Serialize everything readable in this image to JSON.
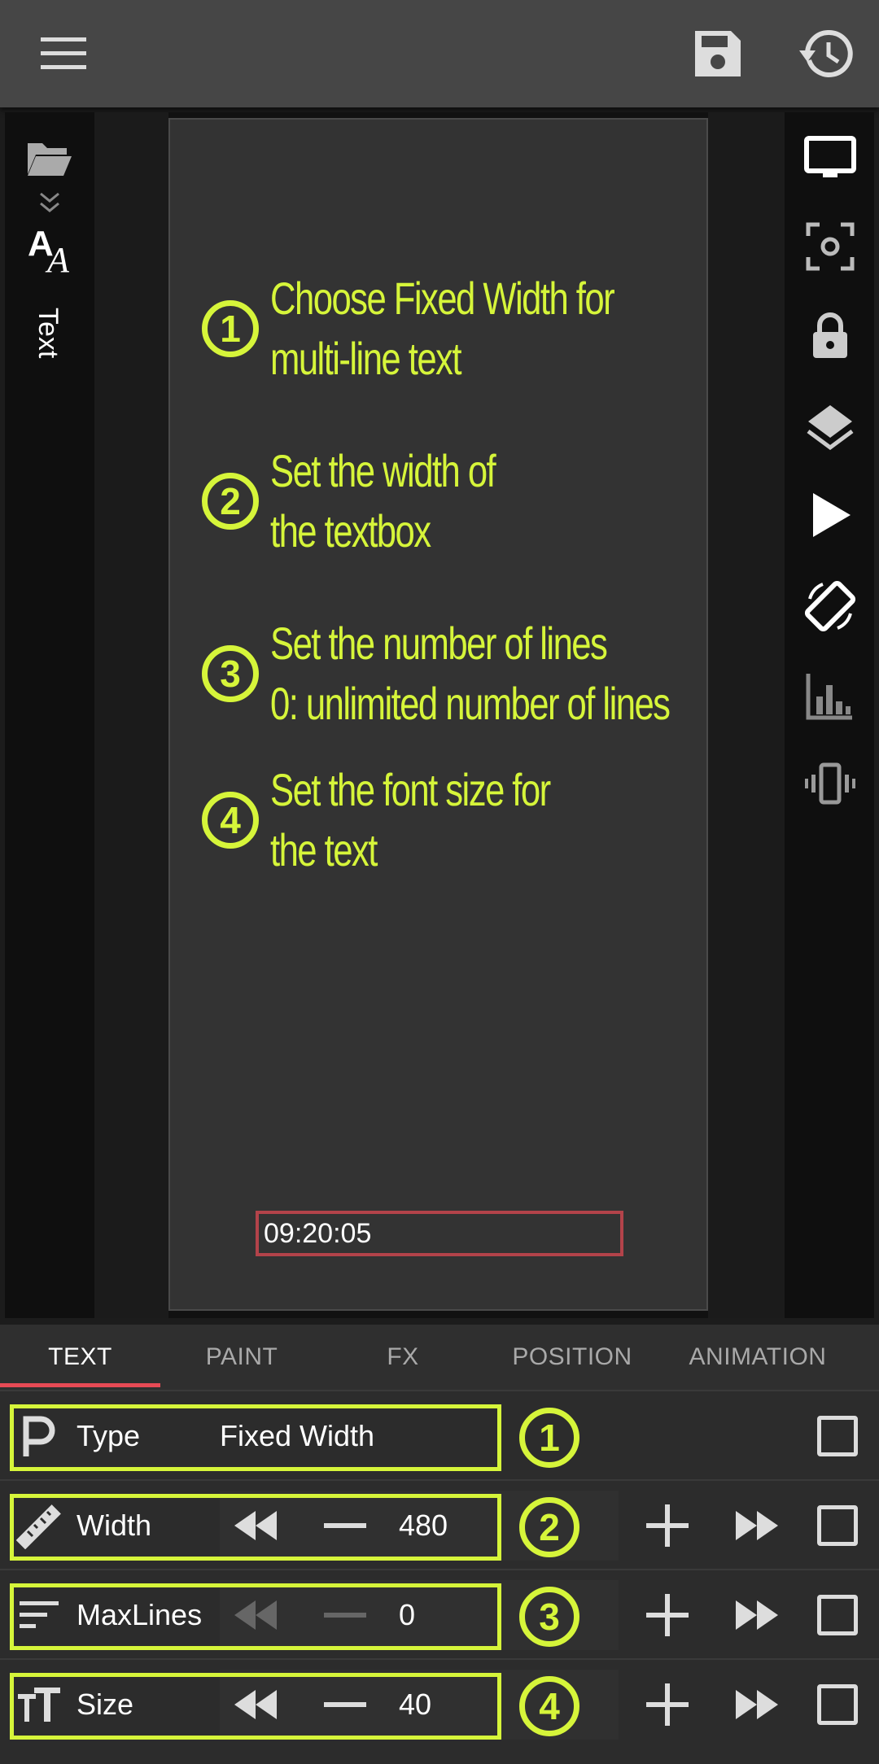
{
  "toolbar": {
    "menu_icon": "menu-icon",
    "save_icon": "save-icon",
    "history_icon": "history-icon"
  },
  "left_panel": {
    "folder_icon": "folder-icon",
    "expand_icon": "double-chevron-down-icon",
    "text_icon": "text-style-icon",
    "text_label": "Text"
  },
  "right_panel": {
    "icons": [
      "screen-icon",
      "focus-icon",
      "lock-icon",
      "layers-icon",
      "play-icon",
      "rotate-icon",
      "chart-icon",
      "vibrate-icon"
    ]
  },
  "canvas": {
    "steps": [
      {
        "num": "1",
        "line1": "Choose Fixed Width for",
        "line2": "multi-line text"
      },
      {
        "num": "2",
        "line1": "Set the width of",
        "line2": "the textbox"
      },
      {
        "num": "3",
        "line1": "Set the number of lines",
        "line2": "0: unlimited number of lines"
      },
      {
        "num": "4",
        "line1": "Set the font size for",
        "line2": "the text"
      }
    ],
    "clock_text": "09:20:05"
  },
  "tabs": [
    {
      "label": "TEXT",
      "active": true
    },
    {
      "label": "PAINT",
      "active": false
    },
    {
      "label": "FX",
      "active": false
    },
    {
      "label": "POSITION",
      "active": false
    },
    {
      "label": "ANIMATION",
      "active": false
    }
  ],
  "properties": [
    {
      "label": "Type",
      "value": "Fixed Width",
      "icon": "paragraph-icon",
      "step": "1"
    },
    {
      "label": "Width",
      "value": "480",
      "icon": "ruler-icon",
      "step": "2"
    },
    {
      "label": "MaxLines",
      "value": "0",
      "icon": "lines-icon",
      "step": "3"
    },
    {
      "label": "Size",
      "value": "40",
      "icon": "font-size-icon",
      "step": "4"
    }
  ],
  "colors": {
    "accent": "#d6f53a",
    "tab_underline": "#e74a55",
    "clock_border": "#b3434a"
  }
}
